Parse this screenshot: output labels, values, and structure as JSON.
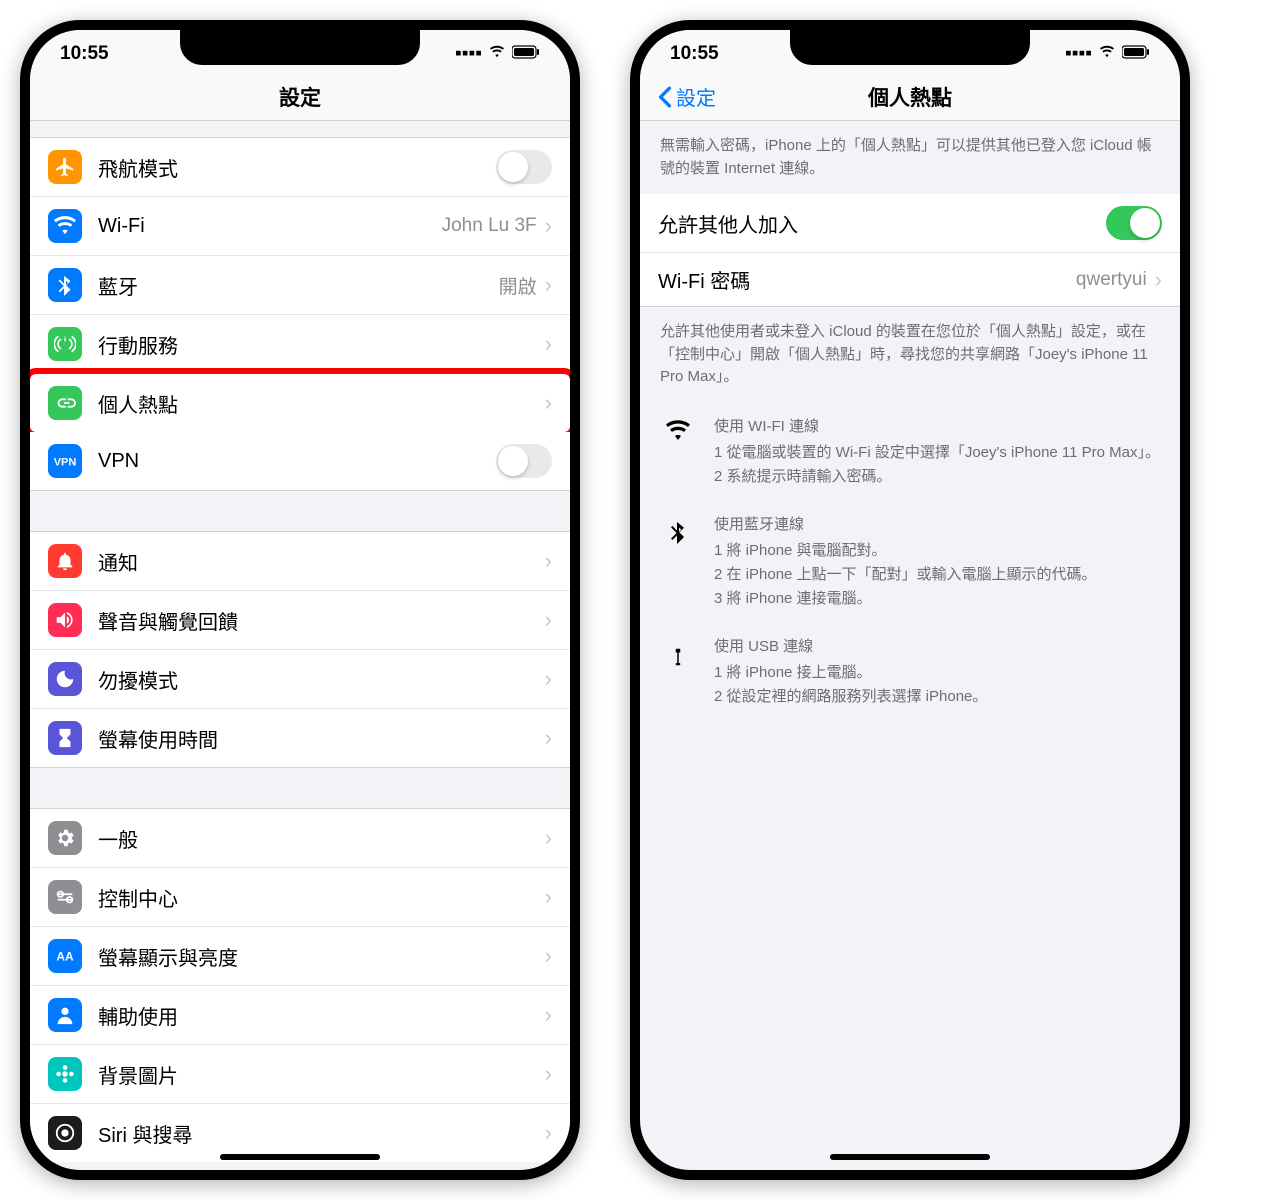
{
  "status": {
    "time": "10:55"
  },
  "left": {
    "title": "設定",
    "rows": [
      {
        "id": "airplane",
        "label": "飛航模式",
        "icon": "airplane",
        "color": "#ff9500",
        "type": "toggle",
        "state": "off"
      },
      {
        "id": "wifi",
        "label": "Wi-Fi",
        "value": "John Lu 3F",
        "icon": "wifi",
        "color": "#007aff",
        "type": "link"
      },
      {
        "id": "bluetooth",
        "label": "藍牙",
        "value": "開啟",
        "icon": "bluetooth",
        "color": "#007aff",
        "type": "link"
      },
      {
        "id": "cellular",
        "label": "行動服務",
        "icon": "antenna",
        "color": "#34c759",
        "type": "link"
      },
      {
        "id": "hotspot",
        "label": "個人熱點",
        "icon": "link",
        "color": "#34c759",
        "type": "link",
        "highlight": true
      },
      {
        "id": "vpn",
        "label": "VPN",
        "icon": "vpn",
        "color": "#007aff",
        "type": "toggle",
        "state": "off"
      }
    ],
    "rows2": [
      {
        "id": "notifications",
        "label": "通知",
        "icon": "bell",
        "color": "#ff3b30",
        "type": "link"
      },
      {
        "id": "sounds",
        "label": "聲音與觸覺回饋",
        "icon": "speaker",
        "color": "#ff2d55",
        "type": "link"
      },
      {
        "id": "dnd",
        "label": "勿擾模式",
        "icon": "moon",
        "color": "#5856d6",
        "type": "link"
      },
      {
        "id": "screentime",
        "label": "螢幕使用時間",
        "icon": "hourglass",
        "color": "#5856d6",
        "type": "link"
      }
    ],
    "rows3": [
      {
        "id": "general",
        "label": "一般",
        "icon": "gear",
        "color": "#8e8e93",
        "type": "link"
      },
      {
        "id": "control",
        "label": "控制中心",
        "icon": "switches",
        "color": "#8e8e93",
        "type": "link"
      },
      {
        "id": "display",
        "label": "螢幕顯示與亮度",
        "icon": "aa",
        "color": "#007aff",
        "type": "link"
      },
      {
        "id": "accessibility",
        "label": "輔助使用",
        "icon": "person",
        "color": "#007aff",
        "type": "link"
      },
      {
        "id": "wallpaper",
        "label": "背景圖片",
        "icon": "flower",
        "color": "#00c7be",
        "type": "link"
      },
      {
        "id": "siri",
        "label": "Siri 與搜尋",
        "icon": "siri",
        "color": "#1c1c1e",
        "type": "link"
      }
    ]
  },
  "right": {
    "back": "設定",
    "title": "個人熱點",
    "intro": "無需輸入密碼，iPhone 上的「個人熱點」可以提供其他已登入您 iCloud 帳號的裝置 Internet 連線。",
    "allow_label": "允許其他人加入",
    "wifi_pw_label": "Wi-Fi 密碼",
    "wifi_pw_value": "qwertyui",
    "note": "允許其他使用者或未登入 iCloud 的裝置在您位於「個人熱點」設定，或在「控制中心」開啟「個人熱點」時，尋找您的共享網路「Joey's iPhone 11 Pro Max」。",
    "help": [
      {
        "icon": "wifi",
        "title": "使用 WI-FI 連線",
        "steps": [
          "1 從電腦或裝置的 Wi-Fi 設定中選擇「Joey's iPhone 11 Pro Max」。",
          "2 系統提示時請輸入密碼。"
        ]
      },
      {
        "icon": "bluetooth",
        "title": "使用藍牙連線",
        "steps": [
          "1 將 iPhone 與電腦配對。",
          "2 在 iPhone 上點一下「配對」或輸入電腦上顯示的代碼。",
          "3 將 iPhone 連接電腦。"
        ]
      },
      {
        "icon": "usb",
        "title": "使用 USB 連線",
        "steps": [
          "1 將 iPhone 接上電腦。",
          "2 從設定裡的網路服務列表選擇 iPhone。"
        ]
      }
    ]
  }
}
